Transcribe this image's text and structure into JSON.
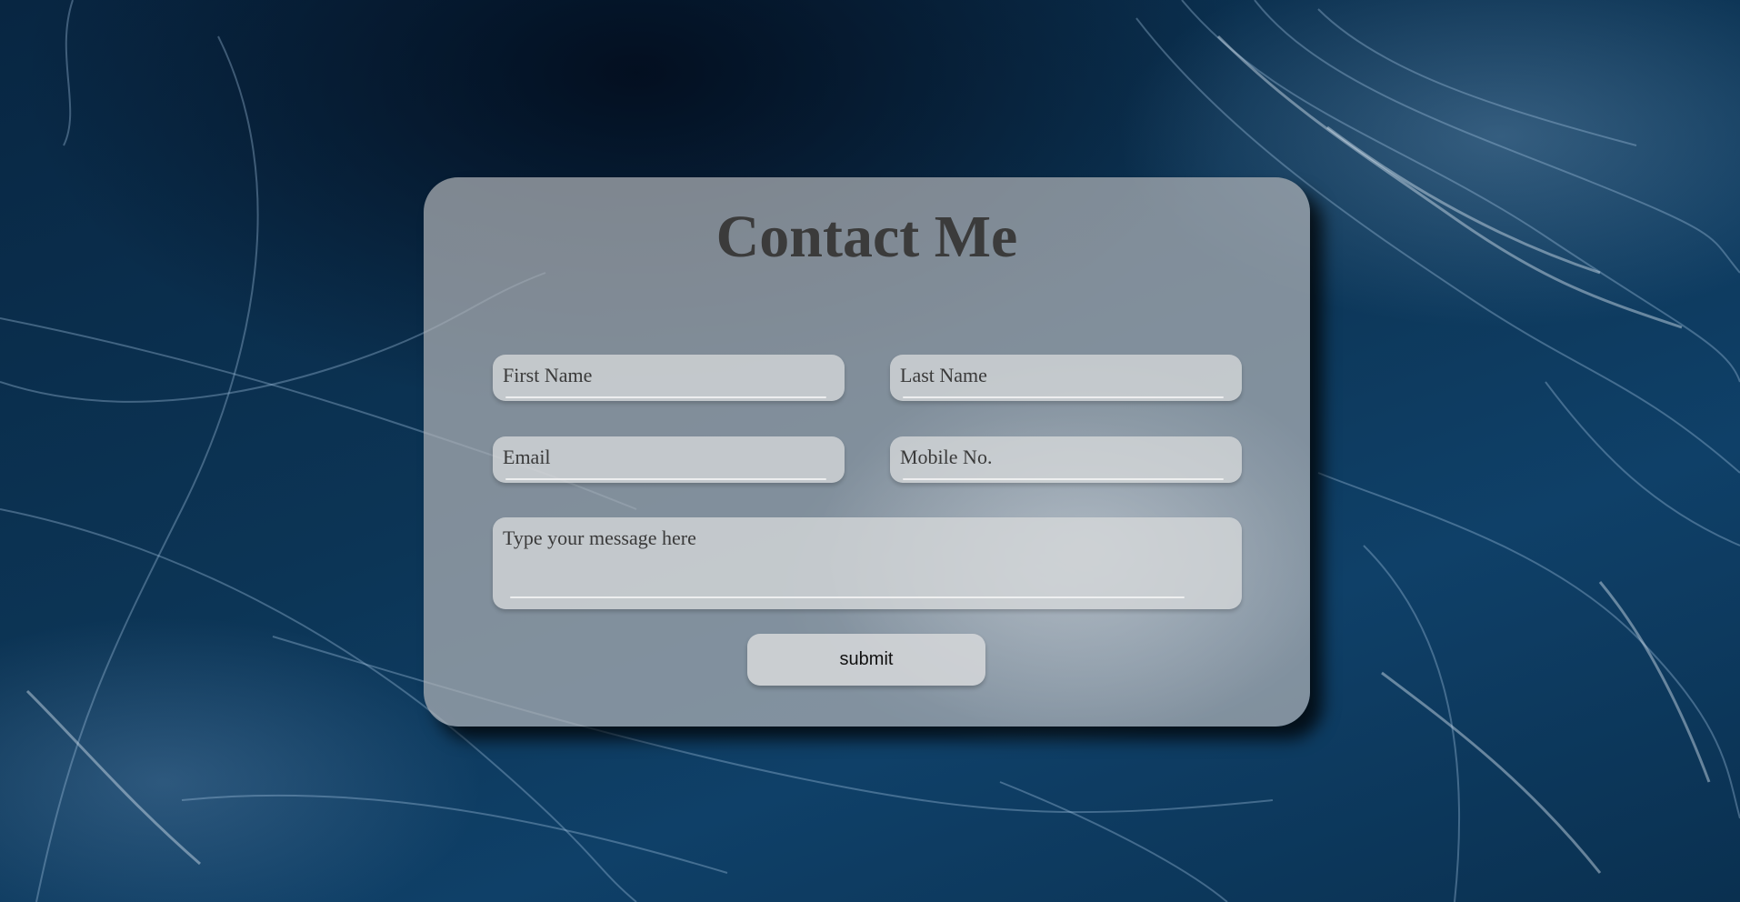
{
  "page": {
    "title": "Contact Me",
    "background_image": "jellyfish-underwater-photo"
  },
  "form": {
    "first_name_placeholder": "First Name",
    "last_name_placeholder": "Last Name",
    "email_placeholder": "Email",
    "mobile_placeholder": "Mobile No.",
    "message_placeholder": "Type your message here",
    "submit_label": "submit"
  },
  "colors": {
    "background": "#0c3556",
    "card": "#a9adb1",
    "title_text": "#3b3b3b",
    "field_bg": "#d6d8da"
  }
}
